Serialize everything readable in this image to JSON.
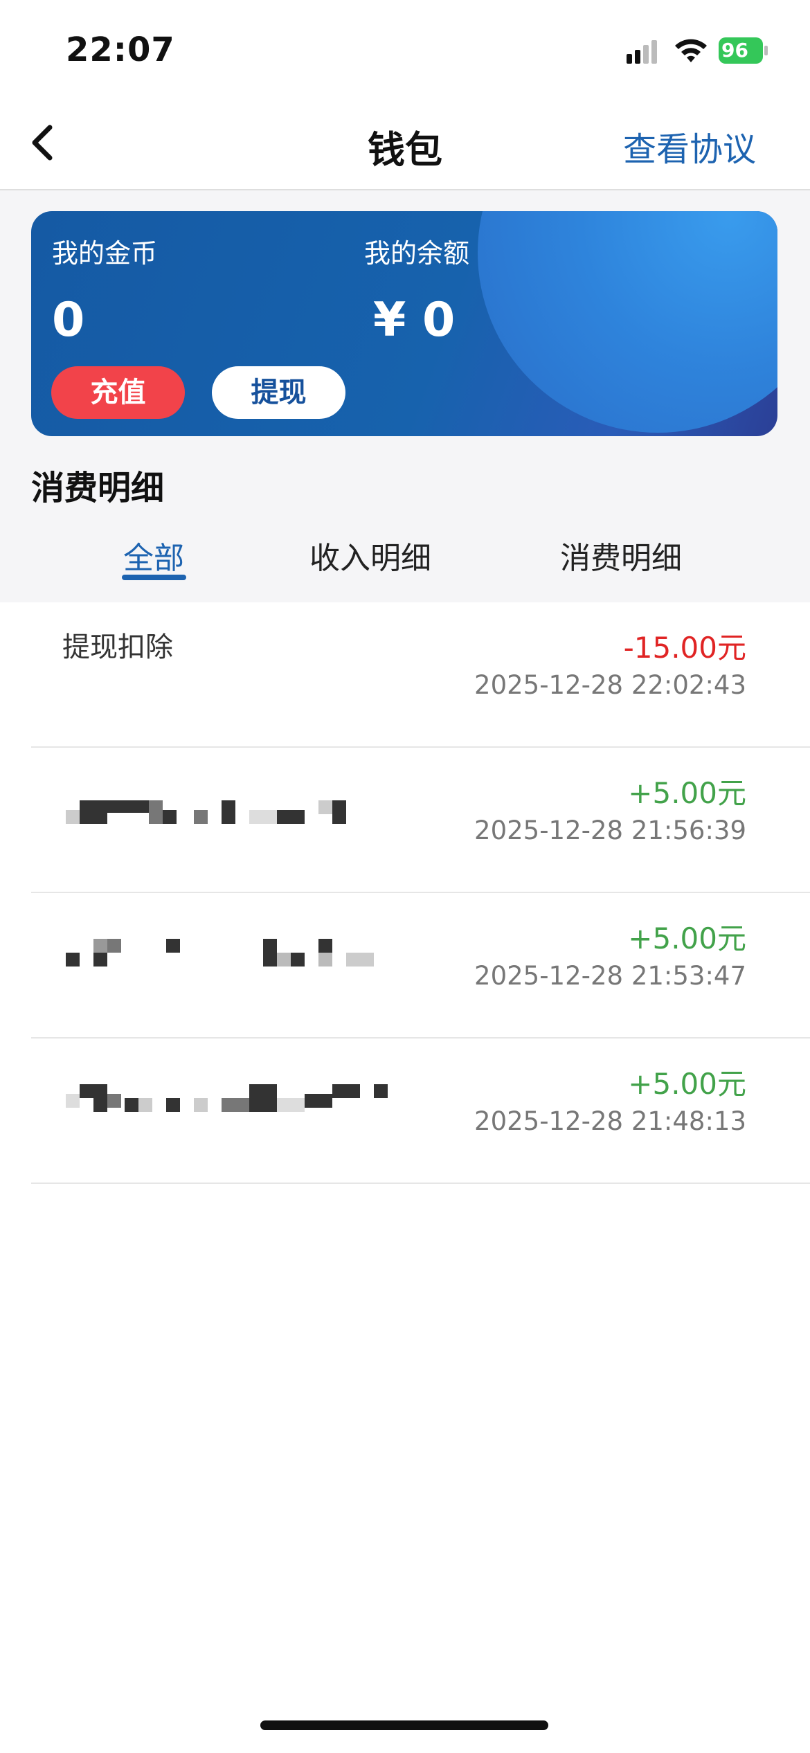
{
  "status_bar": {
    "time": "22:07",
    "battery": "96",
    "icons": [
      "cellular-signal-icon",
      "wifi-icon",
      "battery-charging-icon"
    ]
  },
  "nav": {
    "title": "钱包",
    "right_link": "查看协议",
    "back_icon": "chevron-left-icon"
  },
  "wallet": {
    "coins_label": "我的金币",
    "coins_value": "0",
    "balance_label": "我的余额",
    "balance_value": "¥ 0",
    "recharge_label": "充值",
    "withdraw_label": "提现"
  },
  "section_title": "消费明细",
  "tabs": [
    {
      "label": "全部",
      "active": true
    },
    {
      "label": "收入明细",
      "active": false
    },
    {
      "label": "消费明细",
      "active": false
    }
  ],
  "transactions": [
    {
      "title": "提现扣除",
      "amount": "-15.00元",
      "time": "2025-12-28 22:02:43",
      "type": "expense",
      "redacted": false
    },
    {
      "title": "",
      "amount": "+5.00元",
      "time": "2025-12-28 21:56:39",
      "type": "income",
      "redacted": true
    },
    {
      "title": "",
      "amount": "+5.00元",
      "time": "2025-12-28 21:53:47",
      "type": "income",
      "redacted": true
    },
    {
      "title": "",
      "amount": "+5.00元",
      "time": "2025-12-28 21:48:13",
      "type": "income",
      "redacted": true
    }
  ],
  "colors": {
    "accent": "#1d63b0",
    "recharge": "#f2434a",
    "income": "#42a24a",
    "expense": "#e02424"
  }
}
